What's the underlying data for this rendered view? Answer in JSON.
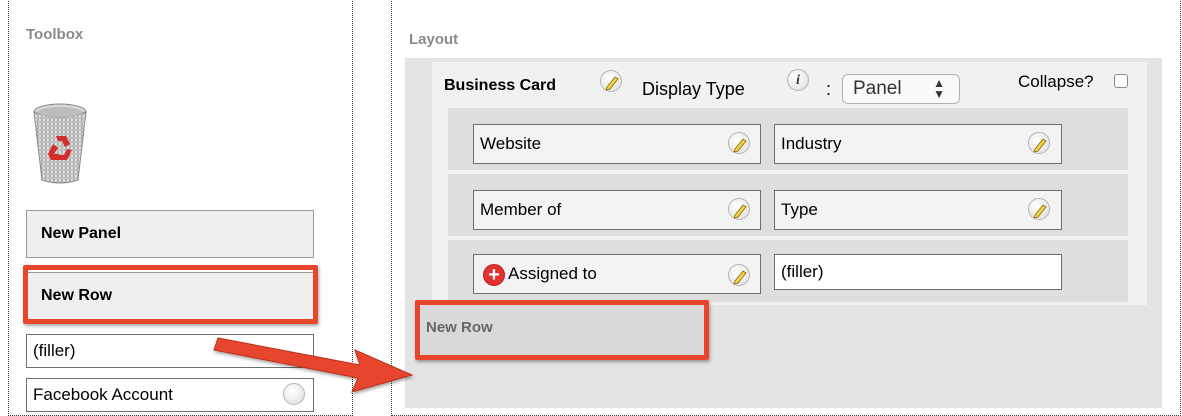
{
  "toolbox": {
    "title": "Toolbox",
    "new_panel": "New Panel",
    "new_row": "New Row",
    "filler": "(filler)",
    "facebook": "Facebook Account"
  },
  "layout": {
    "title": "Layout",
    "panel": {
      "name": "Business Card",
      "display_type_label": "Display Type",
      "colon": ":",
      "display_type_value": "Panel",
      "collapse_label": "Collapse?"
    },
    "rows": [
      {
        "left": "Website",
        "right": "Industry"
      },
      {
        "left": "Member of",
        "right": "Type"
      },
      {
        "left": "Assigned to",
        "right": "(filler)"
      }
    ],
    "new_row_drop": "New Row"
  },
  "colors": {
    "highlight": "#e8452d",
    "arrow": "#e8452d"
  }
}
